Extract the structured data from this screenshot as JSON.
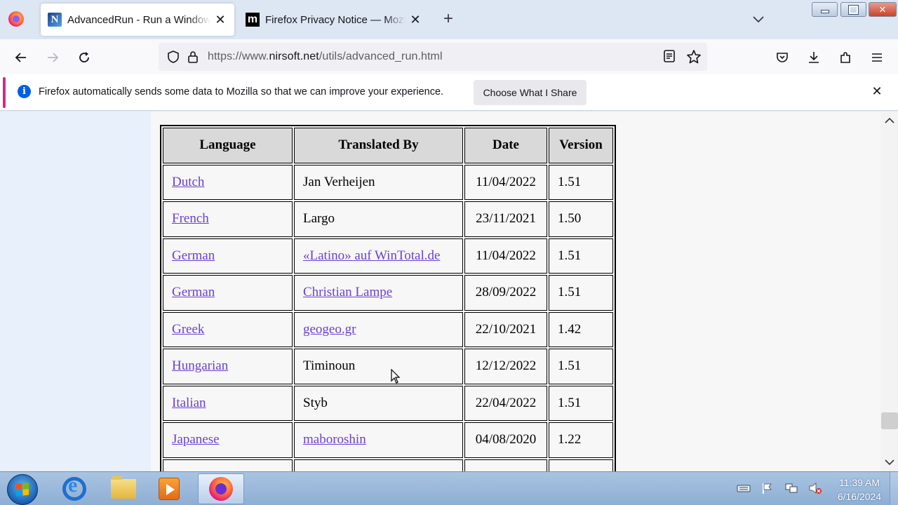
{
  "browser": {
    "tabs": [
      {
        "title": "AdvancedRun - Run a Windows program with different settings",
        "favicon": "N",
        "active": true
      },
      {
        "title": "Firefox Privacy Notice — Mozilla",
        "favicon": "m",
        "active": false
      }
    ],
    "url": {
      "scheme_prefix": "https://www.",
      "host": "nirsoft.net",
      "path": "/utils/advanced_run.html"
    }
  },
  "notification": {
    "message": "Firefox automatically sends some data to Mozilla so that we can improve your experience.",
    "button_label": "Choose What I Share",
    "info_glyph": "i",
    "close_glyph": "✕"
  },
  "table": {
    "headers": [
      "Language",
      "Translated By",
      "Date",
      "Version"
    ],
    "rows": [
      {
        "language": "Dutch",
        "translator": "Jan Verheijen",
        "translator_link": false,
        "date": "11/04/2022",
        "version": "1.51"
      },
      {
        "language": "French",
        "translator": "Largo",
        "translator_link": false,
        "date": "23/11/2021",
        "version": "1.50"
      },
      {
        "language": "German",
        "translator": "«Latino» auf WinTotal.de",
        "translator_link": true,
        "date": "11/04/2022",
        "version": "1.51"
      },
      {
        "language": "German",
        "translator": "Christian Lampe",
        "translator_link": true,
        "date": "28/09/2022",
        "version": "1.51"
      },
      {
        "language": "Greek",
        "translator": "geogeo.gr",
        "translator_link": true,
        "date": "22/10/2021",
        "version": "1.42"
      },
      {
        "language": "Hungarian",
        "translator": "Timinoun",
        "translator_link": false,
        "date": "12/12/2022",
        "version": "1.51"
      },
      {
        "language": "Italian",
        "translator": "Styb",
        "translator_link": false,
        "date": "22/04/2022",
        "version": "1.51"
      },
      {
        "language": "Japanese",
        "translator": "maboroshin",
        "translator_link": true,
        "date": "04/08/2020",
        "version": "1.22"
      },
      {
        "language": "",
        "translator": "",
        "translator_link": false,
        "date": "",
        "version": ""
      }
    ]
  },
  "taskbar": {
    "apps": [
      "internet-explorer",
      "windows-explorer",
      "media-player",
      "firefox"
    ],
    "time": "11:39 AM",
    "date": "6/16/2024"
  },
  "colors": {
    "link": "#6c3fd3",
    "header_bg": "#d9d9d9",
    "accent": "#cb2e8a",
    "info": "#0060df"
  }
}
